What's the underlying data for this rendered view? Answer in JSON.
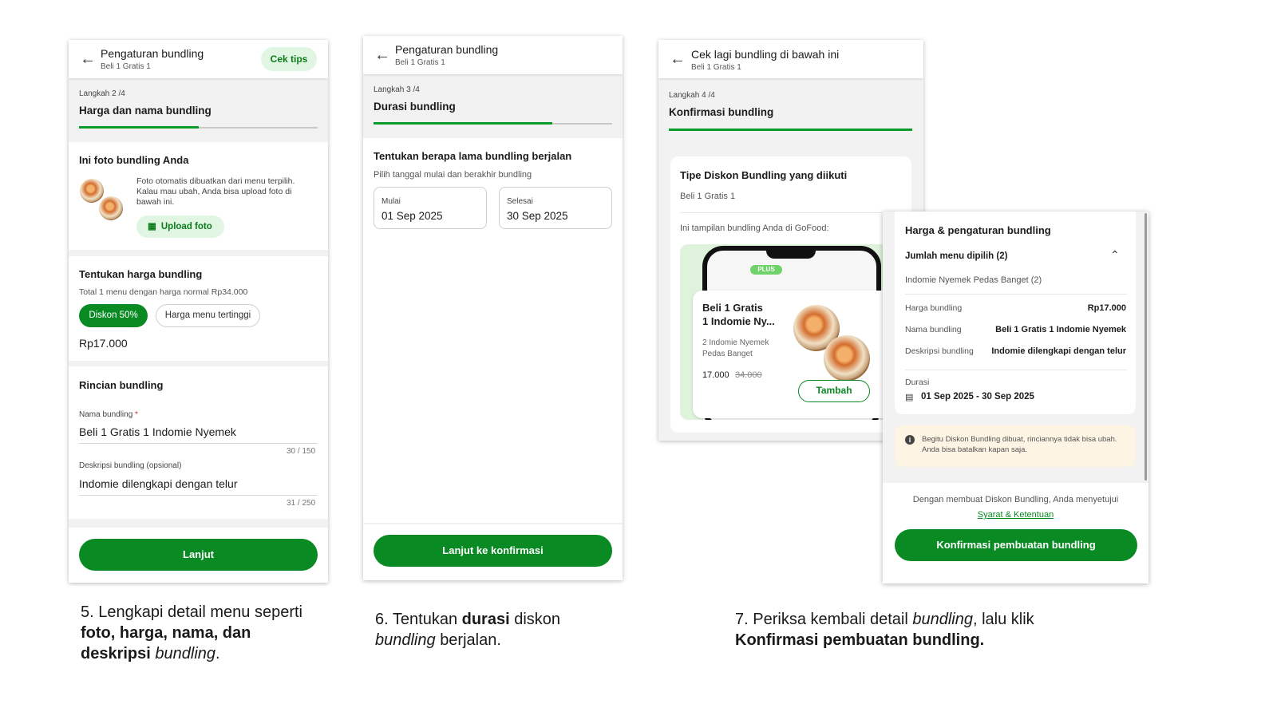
{
  "screen1": {
    "header_title": "Pengaturan bundling",
    "header_subtitle": "Beli 1 Gratis 1",
    "tips_button": "Cek tips",
    "step_label": "Langkah 2 /4",
    "step_title": "Harga dan nama bundling",
    "step_progress": 0.5,
    "photo_section": {
      "title": "Ini foto bundling Anda",
      "description": "Foto otomatis dibuatkan dari menu terpilih. Kalau mau ubah, Anda bisa upload foto di bawah ini.",
      "upload_button": "Upload foto"
    },
    "price_section": {
      "title": "Tentukan harga bundling",
      "subtitle": "Total 1 menu dengan harga normal Rp34.000",
      "option_selected": "Diskon 50%",
      "option_other": "Harga menu tertinggi",
      "price": "Rp17.000"
    },
    "details_section": {
      "title": "Rincian bundling",
      "name_label": "Nama bundling",
      "name_required_mark": "*",
      "name_value": "Beli 1 Gratis 1 Indomie Nyemek",
      "name_counter": "30 / 150",
      "desc_label": "Deskripsi bundling (opsional)",
      "desc_value": "Indomie dilengkapi dengan telur",
      "desc_counter": "31 / 250"
    },
    "next_button": "Lanjut"
  },
  "screen2": {
    "header_title": "Pengaturan bundling",
    "header_subtitle": "Beli 1 Gratis 1",
    "step_label": "Langkah 3 /4",
    "step_title": "Durasi bundling",
    "step_progress": 0.75,
    "section_title": "Tentukan berapa lama bundling berjalan",
    "section_subtitle": "Pilih tanggal mulai dan berakhir bundling",
    "start_label": "Mulai",
    "start_value": "01 Sep 2025",
    "end_label": "Selesai",
    "end_value": "30 Sep 2025",
    "next_button": "Lanjut ke konfirmasi"
  },
  "screen3": {
    "header_title": "Cek lagi bundling di bawah ini",
    "header_subtitle": "Beli 1 Gratis 1",
    "step_label": "Langkah 4 /4",
    "step_title": "Konfirmasi bundling",
    "step_progress": 1.0,
    "type_title": "Tipe Diskon Bundling yang diikuti",
    "type_value": "Beli 1 Gratis 1",
    "preview_label": "Ini tampilan bundling Anda di GoFood:",
    "preview": {
      "badge": "PLUS",
      "title_line1": "Beli 1 Gratis",
      "title_line2": "1 Indomie Ny...",
      "desc_line1": "2 Indomie Nyemek",
      "desc_line2": "Pedas Banget",
      "price": "17.000",
      "old_price": "34.000",
      "add_button": "Tambah"
    }
  },
  "screen4": {
    "title": "Harga & pengaturan bundling",
    "menu_count_label": "Jumlah menu dipilih (2)",
    "menu_item": "Indomie Nyemek Pedas Banget (2)",
    "rows": [
      {
        "label": "Harga bundling",
        "value": "Rp17.000"
      },
      {
        "label": "Nama bundling",
        "value": "Beli 1 Gratis 1 Indomie Nyemek"
      },
      {
        "label": "Deskripsi bundling",
        "value": "Indomie dilengkapi dengan telur"
      }
    ],
    "duration_label": "Durasi",
    "duration_value": "01 Sep 2025 - 30 Sep 2025",
    "notice": "Begitu Diskon Bundling dibuat, rinciannya tidak bisa ubah. Anda bisa batalkan kapan saja.",
    "agreement_text": "Dengan membuat Diskon Bundling, Anda menyetujui",
    "terms_link": "Syarat & Ketentuan",
    "confirm_button": "Konfirmasi pembuatan bundling"
  },
  "captions": {
    "c5_num": "5.",
    "c5_a": "Lengkapi detail menu seperti",
    "c5_b": "foto, harga, nama, dan",
    "c5_c": "deskripsi",
    "c5_d": "bundling",
    "c5_e": ".",
    "c6_num": "6.",
    "c6_a": "Tentukan",
    "c6_b": "durasi",
    "c6_c": "diskon",
    "c6_d": "bundling",
    "c6_e": "berjalan.",
    "c7_num": "7.",
    "c7_a": "Periksa kembali detail",
    "c7_b": "bundling",
    "c7_c": ", lalu klik",
    "c7_d": "Konfirmasi pembuatan bundling."
  },
  "colors": {
    "primary_green": "#0a8a23",
    "light_green": "#e1f5e3",
    "notice_bg": "#fdf4e3"
  }
}
